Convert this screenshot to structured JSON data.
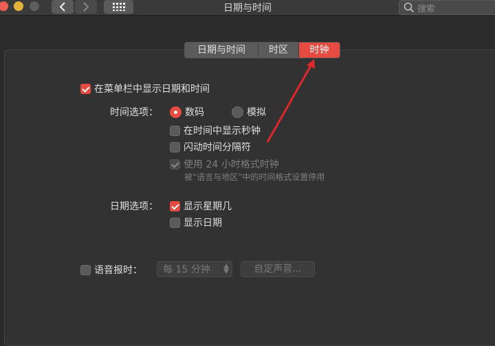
{
  "window": {
    "title": "日期与时间"
  },
  "search": {
    "placeholder": "搜索"
  },
  "tabs": [
    {
      "label": "日期与时间",
      "selected": false
    },
    {
      "label": "时区",
      "selected": false
    },
    {
      "label": "时钟",
      "selected": true
    }
  ],
  "clock": {
    "show_in_menubar": {
      "label": "在菜单栏中显示日期和时间",
      "checked": true
    },
    "time_options": {
      "label": "时间选项：",
      "digital": {
        "label": "数码",
        "selected": true
      },
      "analog": {
        "label": "模拟",
        "selected": false
      },
      "show_seconds": {
        "label": "在时间中显示秒钟",
        "checked": false
      },
      "flash_separators": {
        "label": "闪动时间分隔符",
        "checked": false
      },
      "use_24h": {
        "label": "使用 24 小时格式时钟",
        "checked": true,
        "disabled": true
      },
      "use_24h_note": "被“语言与地区”中的时间格式设置停用"
    },
    "date_options": {
      "label": "日期选项：",
      "show_weekday": {
        "label": "显示星期几",
        "checked": true
      },
      "show_date": {
        "label": "显示日期",
        "checked": false
      }
    },
    "announce": {
      "label": "语音报时：",
      "checked": false,
      "interval": "每 15 分钟",
      "custom_voice_button": "自定声音..."
    }
  },
  "colors": {
    "accent": "#e64a41",
    "background": "#2b2b2b",
    "panel": "#323232"
  }
}
